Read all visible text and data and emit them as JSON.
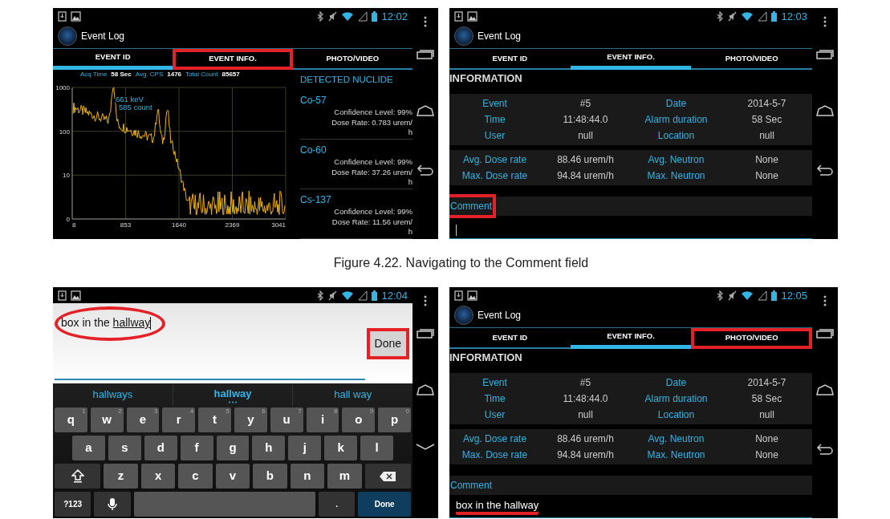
{
  "top_row": [
    {
      "kind": "spectrum",
      "status_time": "12:02",
      "app_title": "Event Log",
      "tabs": [
        {
          "label": "EVENT ID",
          "selected": true,
          "highlighted": false
        },
        {
          "label": "EVENT INFO.",
          "selected": false,
          "highlighted": true
        },
        {
          "label": "PHOTO/VIDEO",
          "selected": false,
          "highlighted": false
        }
      ],
      "stats": [
        {
          "label": "Acq Time",
          "value": "58 Sec"
        },
        {
          "label": "Avg. CPS",
          "value": "1476"
        },
        {
          "label": "Total Count",
          "value": "85657"
        }
      ],
      "y_ticks": [
        "1000",
        "100",
        "10",
        "0"
      ],
      "x_ticks": [
        "8",
        "853",
        "1640",
        "2369",
        "3041"
      ],
      "peak_label": [
        "661 keV",
        "585 count"
      ],
      "nuclide_heading": "DETECTED NUCLIDE",
      "nuclides": [
        {
          "name": "Co-57",
          "confidence": "Confidence Level: 99%",
          "dose_rate": "Dose Rate: 0.783 urem/h"
        },
        {
          "name": "Co-60",
          "confidence": "Confidence Level: 99%",
          "dose_rate": "Dose Rate: 37.26 urem/h"
        },
        {
          "name": "Cs-137",
          "confidence": "Confidence Level: 99%",
          "dose_rate": "Dose Rate: 11.56 urem/h"
        }
      ]
    },
    {
      "kind": "info",
      "status_time": "12:03",
      "app_title": "Event Log",
      "tabs": [
        {
          "label": "EVENT ID",
          "selected": false,
          "highlighted": false
        },
        {
          "label": "EVENT INFO.",
          "selected": true,
          "highlighted": false
        },
        {
          "label": "PHOTO/VIDEO",
          "selected": false,
          "highlighted": false
        }
      ],
      "heading": "INFORMATION",
      "groups": [
        [
          [
            "Event",
            "#5",
            "Date",
            "2014-5-7"
          ],
          [
            "Time",
            "11:48:44.0",
            "Alarm duration",
            "58 Sec"
          ],
          [
            "User",
            "null",
            "Location",
            "null"
          ]
        ],
        [
          [
            "Avg. Dose rate",
            "88.46 urem/h",
            "Avg. Neutron",
            "None"
          ],
          [
            "Max. Dose rate",
            "94.84 urem/h",
            "Max. Neutron",
            "None"
          ]
        ]
      ],
      "comment": {
        "label": "Comment",
        "highlighted": true,
        "focused": true
      }
    }
  ],
  "caption": "Figure 4.22. Navigating to the Comment field",
  "bottom_row": [
    {
      "kind": "keyboard",
      "status_time": "12:04",
      "input": {
        "text": "box in the",
        "composing": "hallway",
        "circled": true,
        "focused": true
      },
      "done": {
        "label": "Done",
        "highlighted": true
      },
      "suggestions": [
        {
          "label": "hallways",
          "selected": false
        },
        {
          "label": "hallway",
          "selected": true
        },
        {
          "label": "hall way",
          "selected": false
        }
      ],
      "key_rows": [
        [
          {
            "kind": "char",
            "label": "q",
            "hint": "1"
          },
          {
            "kind": "char",
            "label": "w",
            "hint": "2"
          },
          {
            "kind": "char",
            "label": "e",
            "hint": "3"
          },
          {
            "kind": "char",
            "label": "r",
            "hint": "4"
          },
          {
            "kind": "char",
            "label": "t",
            "hint": "5"
          },
          {
            "kind": "char",
            "label": "y",
            "hint": "6"
          },
          {
            "kind": "char",
            "label": "u",
            "hint": "7"
          },
          {
            "kind": "char",
            "label": "i",
            "hint": "8"
          },
          {
            "kind": "char",
            "label": "o",
            "hint": "9"
          },
          {
            "kind": "char",
            "label": "p",
            "hint": "0"
          }
        ],
        [
          {
            "kind": "char",
            "label": "a"
          },
          {
            "kind": "char",
            "label": "s"
          },
          {
            "kind": "char",
            "label": "d"
          },
          {
            "kind": "char",
            "label": "f"
          },
          {
            "kind": "char",
            "label": "g"
          },
          {
            "kind": "char",
            "label": "h"
          },
          {
            "kind": "char",
            "label": "j"
          },
          {
            "kind": "char",
            "label": "k"
          },
          {
            "kind": "char",
            "label": "l"
          }
        ],
        [
          {
            "kind": "shift"
          },
          {
            "kind": "char",
            "label": "z"
          },
          {
            "kind": "char",
            "label": "x"
          },
          {
            "kind": "char",
            "label": "c"
          },
          {
            "kind": "char",
            "label": "v"
          },
          {
            "kind": "char",
            "label": "b"
          },
          {
            "kind": "char",
            "label": "n"
          },
          {
            "kind": "char",
            "label": "m"
          },
          {
            "kind": "backspace"
          }
        ],
        [
          {
            "kind": "symbols",
            "label": "?123"
          },
          {
            "kind": "mic"
          },
          {
            "kind": "space"
          },
          {
            "kind": "symbols",
            "label": "."
          },
          {
            "kind": "action",
            "label": "Done"
          }
        ]
      ]
    },
    {
      "kind": "info",
      "status_time": "12:05",
      "app_title": "Event Log",
      "tabs": [
        {
          "label": "EVENT ID",
          "selected": false,
          "highlighted": false
        },
        {
          "label": "EVENT INFO.",
          "selected": true,
          "highlighted": false
        },
        {
          "label": "PHOTO/VIDEO",
          "selected": false,
          "highlighted": true
        }
      ],
      "heading": "INFORMATION",
      "groups": [
        [
          [
            "Event",
            "#5",
            "Date",
            "2014-5-7"
          ],
          [
            "Time",
            "11:48:44.0",
            "Alarm duration",
            "58 Sec"
          ],
          [
            "User",
            "null",
            "Location",
            "null"
          ]
        ],
        [
          [
            "Avg. Dose rate",
            "88.46 urem/h",
            "Avg. Neutron",
            "None"
          ],
          [
            "Max. Dose rate",
            "94.84 urem/h",
            "Max. Neutron",
            "None"
          ]
        ]
      ],
      "comment": {
        "label": "Comment",
        "highlighted": false,
        "focused": false,
        "underlined": true,
        "value": "box in the hallway"
      }
    }
  ]
}
